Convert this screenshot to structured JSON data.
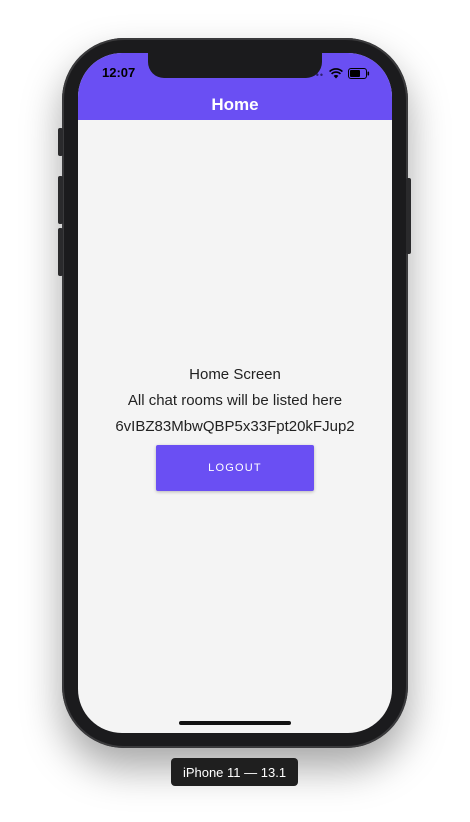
{
  "status_bar": {
    "time": "12:07"
  },
  "header": {
    "title": "Home"
  },
  "main": {
    "screen_title": "Home Screen",
    "description": "All chat rooms will be listed here",
    "user_id": "6vIBZ83MbwQBP5x33Fpt20kFJup2",
    "logout_label": "LOGOUT"
  },
  "simulator": {
    "device_label": "iPhone 11 — 13.1"
  },
  "colors": {
    "accent": "#6a4ff3",
    "background": "#f4f4f4",
    "device_frame": "#1b1b1d"
  },
  "icons": {
    "wifi": "wifi-icon",
    "battery": "battery-icon",
    "signal": "signal-icon"
  }
}
